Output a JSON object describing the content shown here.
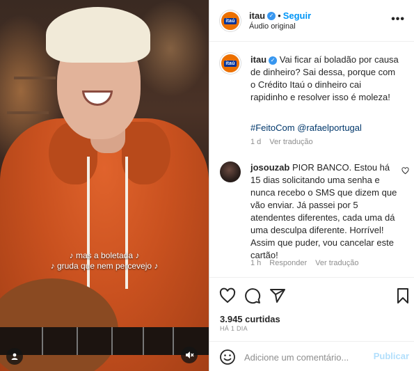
{
  "media": {
    "caption_line1": "♪ mas a boletada ♪",
    "caption_line2": "♪ gruda que nem percevejo ♪",
    "user_icon": "person-icon",
    "mute_icon": "speaker-muted-icon"
  },
  "header": {
    "username": "itau",
    "verified_icon": "verified-badge-icon",
    "separator": "•",
    "follow_label": "Seguir",
    "audio_label": "Áudio original",
    "more_icon": "more-options-icon",
    "logo_text": "itaú"
  },
  "post": {
    "username": "itau",
    "text": "Vai ficar aí boladão por causa de dinheiro? Sai dessa, porque com o Crédito Itaú o dinheiro cai rapidinho e resolver isso é moleza!",
    "hashtag": "#FeitoCom",
    "mention": "@rafaelportugal",
    "age": "1 d",
    "see_translation": "Ver tradução"
  },
  "comment": {
    "username": "josouzab",
    "text": "PIOR BANCO. Estou há 15 dias solicitando uma senha e nunca recebo o SMS que dizem que vão enviar. Já passei por 5 atendentes diferentes, cada uma dá uma desculpa diferente. Horrível! Assim que puder, vou cancelar este cartão!",
    "age": "1 h",
    "reply_label": "Responder",
    "see_translation": "Ver tradução",
    "like_icon": "heart-outline-icon"
  },
  "actions": {
    "like_icon": "heart-icon",
    "comment_icon": "comment-icon",
    "share_icon": "share-icon",
    "save_icon": "bookmark-icon",
    "likes": "3.945 curtidas",
    "posted": "HÁ 1 DIA"
  },
  "composer": {
    "emoji_icon": "emoji-icon",
    "placeholder": "Adicione um comentário...",
    "publish_label": "Publicar"
  },
  "colors": {
    "brand_orange": "#ec7000",
    "brand_blue": "#003399",
    "link_blue": "#0095f6",
    "publish_disabled": "#b2dffc",
    "verified_blue": "#3897f0"
  }
}
